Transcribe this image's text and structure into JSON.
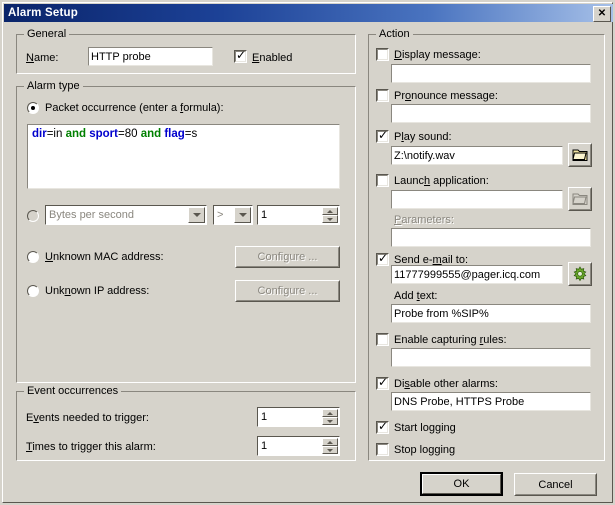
{
  "window": {
    "title": "Alarm Setup",
    "close_label": "✕",
    "close_icon": "close-icon"
  },
  "general": {
    "legend": "General",
    "name_label": "Name:",
    "name_value": "HTTP probe",
    "enabled_label": "Enabled",
    "enabled_checked": true
  },
  "alarm_type": {
    "legend": "Alarm type",
    "packet_occurrence": {
      "label": "Packet occurrence (enter a formula):",
      "selected": true,
      "formula_tokens": [
        {
          "text": "dir",
          "kind": "keyword"
        },
        {
          "text": "=",
          "kind": "plain"
        },
        {
          "text": "in",
          "kind": "plain"
        },
        {
          "text": " ",
          "kind": "plain"
        },
        {
          "text": "and",
          "kind": "operator"
        },
        {
          "text": " ",
          "kind": "plain"
        },
        {
          "text": "sport",
          "kind": "keyword"
        },
        {
          "text": "=",
          "kind": "plain"
        },
        {
          "text": "80",
          "kind": "plain"
        },
        {
          "text": " ",
          "kind": "plain"
        },
        {
          "text": "and",
          "kind": "operator"
        },
        {
          "text": " ",
          "kind": "plain"
        },
        {
          "text": "flag",
          "kind": "keyword"
        },
        {
          "text": "=",
          "kind": "plain"
        },
        {
          "text": "s",
          "kind": "plain"
        }
      ],
      "formula_plain": "dir=in and sport=80 and flag=s"
    },
    "threshold": {
      "selected": false,
      "enabled": false,
      "metric_value": "Bytes per second",
      "comparison_value": ">",
      "amount_value": "1"
    },
    "unknown_mac": {
      "label": "Unknown MAC address:",
      "selected": false,
      "button_label": "Configure ...",
      "button_enabled": false
    },
    "unknown_ip": {
      "label": "Unknown IP address:",
      "selected": false,
      "button_label": "Configure ...",
      "button_enabled": false
    }
  },
  "event_occurrences": {
    "legend": "Event occurrences",
    "events_needed_label": "Events needed to trigger:",
    "events_needed_value": "1",
    "times_trigger_label": "Times to trigger this alarm:",
    "times_trigger_value": "1"
  },
  "action": {
    "legend": "Action",
    "display_message": {
      "label": "Display message:",
      "checked": false,
      "value": ""
    },
    "pronounce_message": {
      "label": "Pronounce message:",
      "checked": false,
      "value": ""
    },
    "play_sound": {
      "label": "Play sound:",
      "checked": true,
      "value": "Z:\\notify.wav",
      "browse_icon": "folder-icon"
    },
    "launch_application": {
      "label": "Launch application:",
      "checked": false,
      "value": "",
      "browse_icon": "folder-icon",
      "parameters_label": "Parameters:",
      "parameters_value": "",
      "parameters_enabled": false
    },
    "send_email": {
      "label": "Send e-mail to:",
      "checked": true,
      "value": "11777999555@pager.icq.com",
      "settings_icon": "gear-icon",
      "add_text_label": "Add text:",
      "add_text_value": "Probe from %SIP%"
    },
    "enable_capturing_rules": {
      "label": "Enable capturing rules:",
      "checked": false,
      "value": ""
    },
    "disable_other_alarms": {
      "label": "Disable other alarms:",
      "checked": true,
      "value": "DNS Probe, HTTPS Probe"
    },
    "start_logging": {
      "label": "Start logging",
      "checked": true
    },
    "stop_logging": {
      "label": "Stop logging",
      "checked": false
    }
  },
  "footer": {
    "ok_label": "OK",
    "cancel_label": "Cancel"
  },
  "colors": {
    "titlebar_start": "#0a246a",
    "titlebar_end": "#a6c0e8",
    "dialog_bg": "#d6d3cb",
    "keyword": "#0000cd",
    "operator": "#008000",
    "folder_icon": "#f0e080",
    "gear_icon": "#7cb342"
  }
}
